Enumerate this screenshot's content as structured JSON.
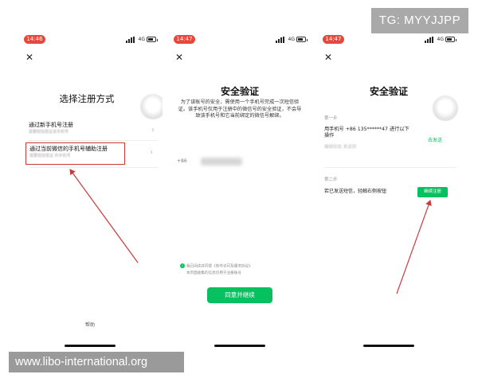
{
  "watermarks": {
    "tg": "TG: MYYJJPP",
    "site": "www.libo-international.org"
  },
  "status": {
    "network": "4G"
  },
  "screen1": {
    "time": "14:46",
    "title": "选择注册方式",
    "options": [
      {
        "label": "通过新手机号注册",
        "sub": "需要短信验证该手机号"
      },
      {
        "label": "通过当前微信的手机号辅助注册",
        "sub": "需要短信验证 的手机号"
      }
    ],
    "help": "帮助"
  },
  "screen2": {
    "time": "14:47",
    "title": "安全验证",
    "description": "为了该账号的安全，需使用一个手机号完成一次短信验证。该手机号仅用于注册中的微信号的安全验证，不会导致该手机号和它当前绑定的微信号解绑。",
    "country_code": "+86",
    "agree_line1": "我已阅读并同意《软件许可及服务协议》",
    "agree_line2": "本页面收集的信息仅用于注册账号",
    "button": "同意并继续"
  },
  "screen3": {
    "time": "14:47",
    "title": "安全验证",
    "step1_label": "第一步",
    "step1_text_a": "用手机号 +86 135******47 进行以下",
    "step1_text_b": "操作",
    "step1_hint": "编辑短信 发送到",
    "send_link": "去发送",
    "step2_label": "第二步",
    "step2_text": "若已发送短信，轻触右侧按钮",
    "continue_button": "继续注册"
  },
  "colors": {
    "accent": "#07c160",
    "highlight": "#c93b3b",
    "time_pill": "#e8473d"
  }
}
